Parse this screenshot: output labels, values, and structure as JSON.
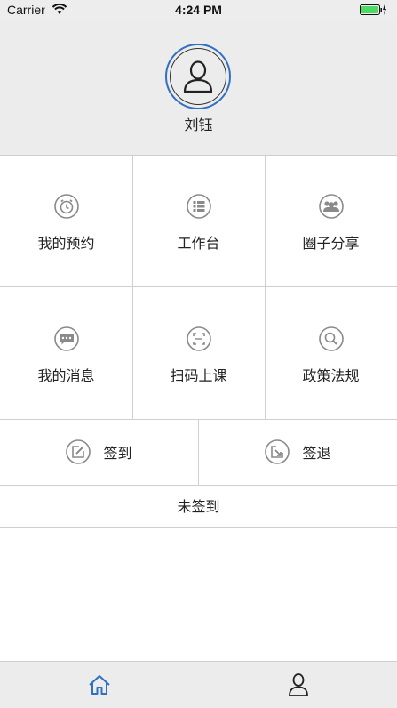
{
  "status_bar": {
    "carrier": "Carrier",
    "time": "4:24 PM"
  },
  "profile": {
    "name": "刘钰",
    "avatar_icon": "user-icon"
  },
  "grid": [
    {
      "label": "我的预约",
      "icon": "alarm-clock-icon"
    },
    {
      "label": "工作台",
      "icon": "list-icon"
    },
    {
      "label": "圈子分享",
      "icon": "group-icon"
    },
    {
      "label": "我的消息",
      "icon": "chat-icon"
    },
    {
      "label": "扫码上课",
      "icon": "scan-icon"
    },
    {
      "label": "政策法规",
      "icon": "search-icon"
    }
  ],
  "sign": {
    "sign_in": {
      "label": "签到",
      "icon": "edit-icon"
    },
    "sign_out": {
      "label": "签退",
      "icon": "exit-icon"
    },
    "status": "未签到"
  },
  "tabbar": [
    {
      "icon": "home-icon",
      "active": true
    },
    {
      "icon": "user-icon",
      "active": false
    }
  ],
  "colors": {
    "accent": "#2f6fc4",
    "icon_gray": "#8a8a8a",
    "battery": "#4cd964"
  }
}
